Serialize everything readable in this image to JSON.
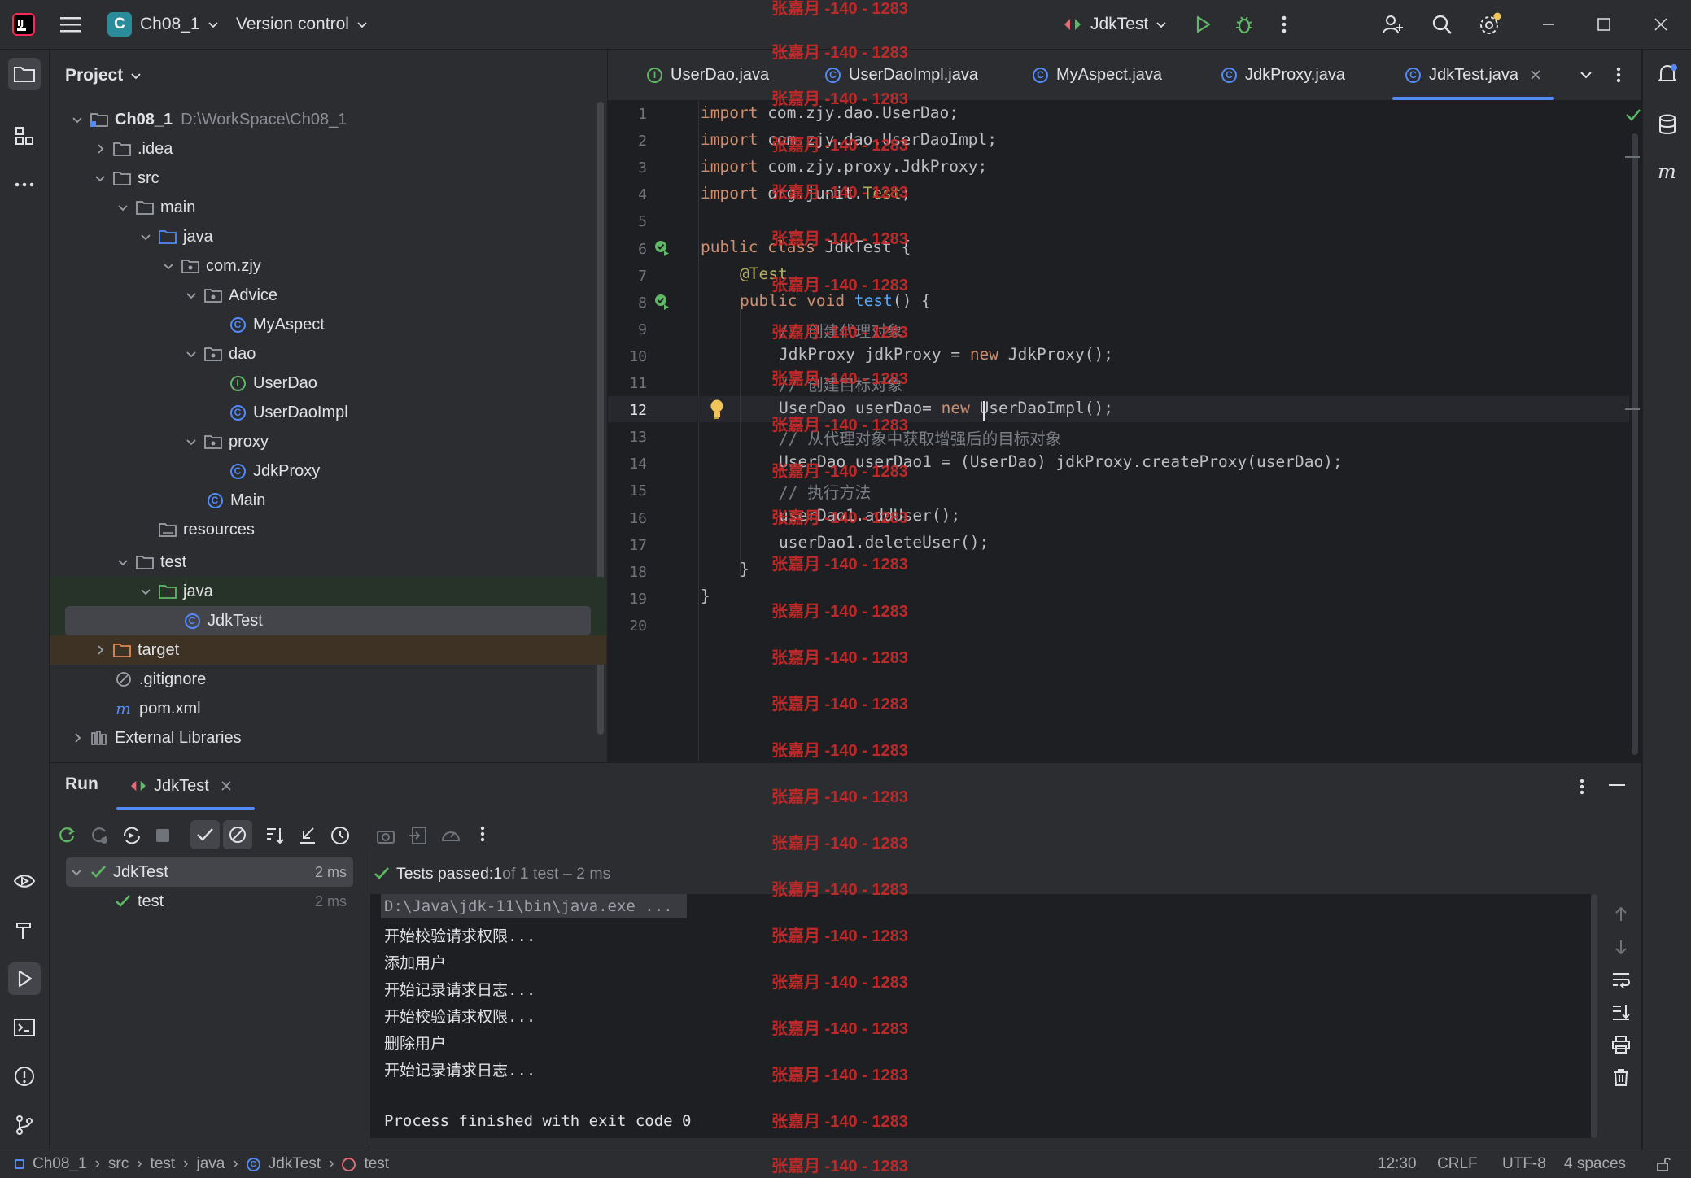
{
  "titlebar": {
    "project_name": "Ch08_1",
    "project_badge": "C",
    "vcs_label": "Version control",
    "run_config": "JdkTest"
  },
  "project_panel": {
    "title": "Project",
    "tree": [
      {
        "label": "Ch08_1",
        "path": "D:\\WorkSpace\\Ch08_1"
      },
      {
        "label": ".idea"
      },
      {
        "label": "src"
      },
      {
        "label": "main"
      },
      {
        "label": "java"
      },
      {
        "label": "com.zjy"
      },
      {
        "label": "Advice"
      },
      {
        "label": "MyAspect"
      },
      {
        "label": "dao"
      },
      {
        "label": "UserDao"
      },
      {
        "label": "UserDaoImpl"
      },
      {
        "label": "proxy"
      },
      {
        "label": "JdkProxy"
      },
      {
        "label": "Main"
      },
      {
        "label": "resources"
      },
      {
        "label": "test"
      },
      {
        "label": "java"
      },
      {
        "label": "JdkTest"
      },
      {
        "label": "target"
      },
      {
        "label": ".gitignore"
      },
      {
        "label": "pom.xml"
      },
      {
        "label": "External Libraries"
      }
    ]
  },
  "editor": {
    "tabs": [
      "UserDao.java",
      "UserDaoImpl.java",
      "MyAspect.java",
      "JdkProxy.java",
      "JdkTest.java"
    ],
    "line_numbers": [
      "1",
      "2",
      "3",
      "4",
      "5",
      "6",
      "7",
      "8",
      "9",
      "10",
      "11",
      "12",
      "13",
      "14",
      "15",
      "16",
      "17",
      "18",
      "19",
      "20"
    ],
    "code": {
      "l1": "import com.zjy.dao.UserDao;",
      "l2": "import com.zjy.dao.UserDaoImpl;",
      "l3": "import com.zjy.proxy.JdkProxy;",
      "l4_a": "import org.junit.",
      "l4_b": "Test",
      "l4_c": ";",
      "l6_a": "public class ",
      "l6_b": "JdkTest {",
      "l7": "@Test",
      "l8_a": "public void ",
      "l8_b": "test",
      "l8_c": "() {",
      "l9": "// 创建代理对象",
      "l10_a": "JdkProxy jdkProxy = ",
      "l10_b": "new",
      "l10_c": " JdkProxy();",
      "l11": "// 创建目标对象",
      "l12_a": "UserDao userDao= ",
      "l12_b": "new",
      "l12_c": " UserDaoImpl();",
      "l13": "// 从代理对象中获取增强后的目标对象",
      "l14": "UserDao userDao1 = (UserDao) jdkProxy.createProxy(userDao);",
      "l15": "// 执行方法",
      "l16": "userDao1.addUser();",
      "l17": "userDao1.deleteUser();",
      "l18": "}",
      "l19": "}"
    }
  },
  "run_panel": {
    "title": "Run",
    "tab": "JdkTest",
    "tests": [
      {
        "name": "JdkTest",
        "time": "2 ms"
      },
      {
        "name": "test",
        "time": "2 ms"
      }
    ],
    "summary_prefix": "Tests passed: ",
    "summary_count": "1",
    "summary_suffix": " of 1 test – 2 ms",
    "console": [
      "D:\\Java\\jdk-11\\bin\\java.exe ...",
      "开始校验请求权限...",
      "添加用户",
      "开始记录请求日志...",
      "开始校验请求权限...",
      "删除用户",
      "开始记录请求日志...",
      "",
      "Process finished with exit code 0"
    ]
  },
  "statusbar": {
    "crumbs": [
      "Ch08_1",
      "src",
      "test",
      "java",
      "JdkTest",
      "test"
    ],
    "position": "12:30",
    "line_sep": "CRLF",
    "encoding": "UTF-8",
    "indent": "4 spaces"
  },
  "watermark": "张嘉月 -140 - 1283",
  "colors": {
    "accent": "#548af7",
    "success": "#5fb865",
    "watermark": "#c92a2a"
  }
}
